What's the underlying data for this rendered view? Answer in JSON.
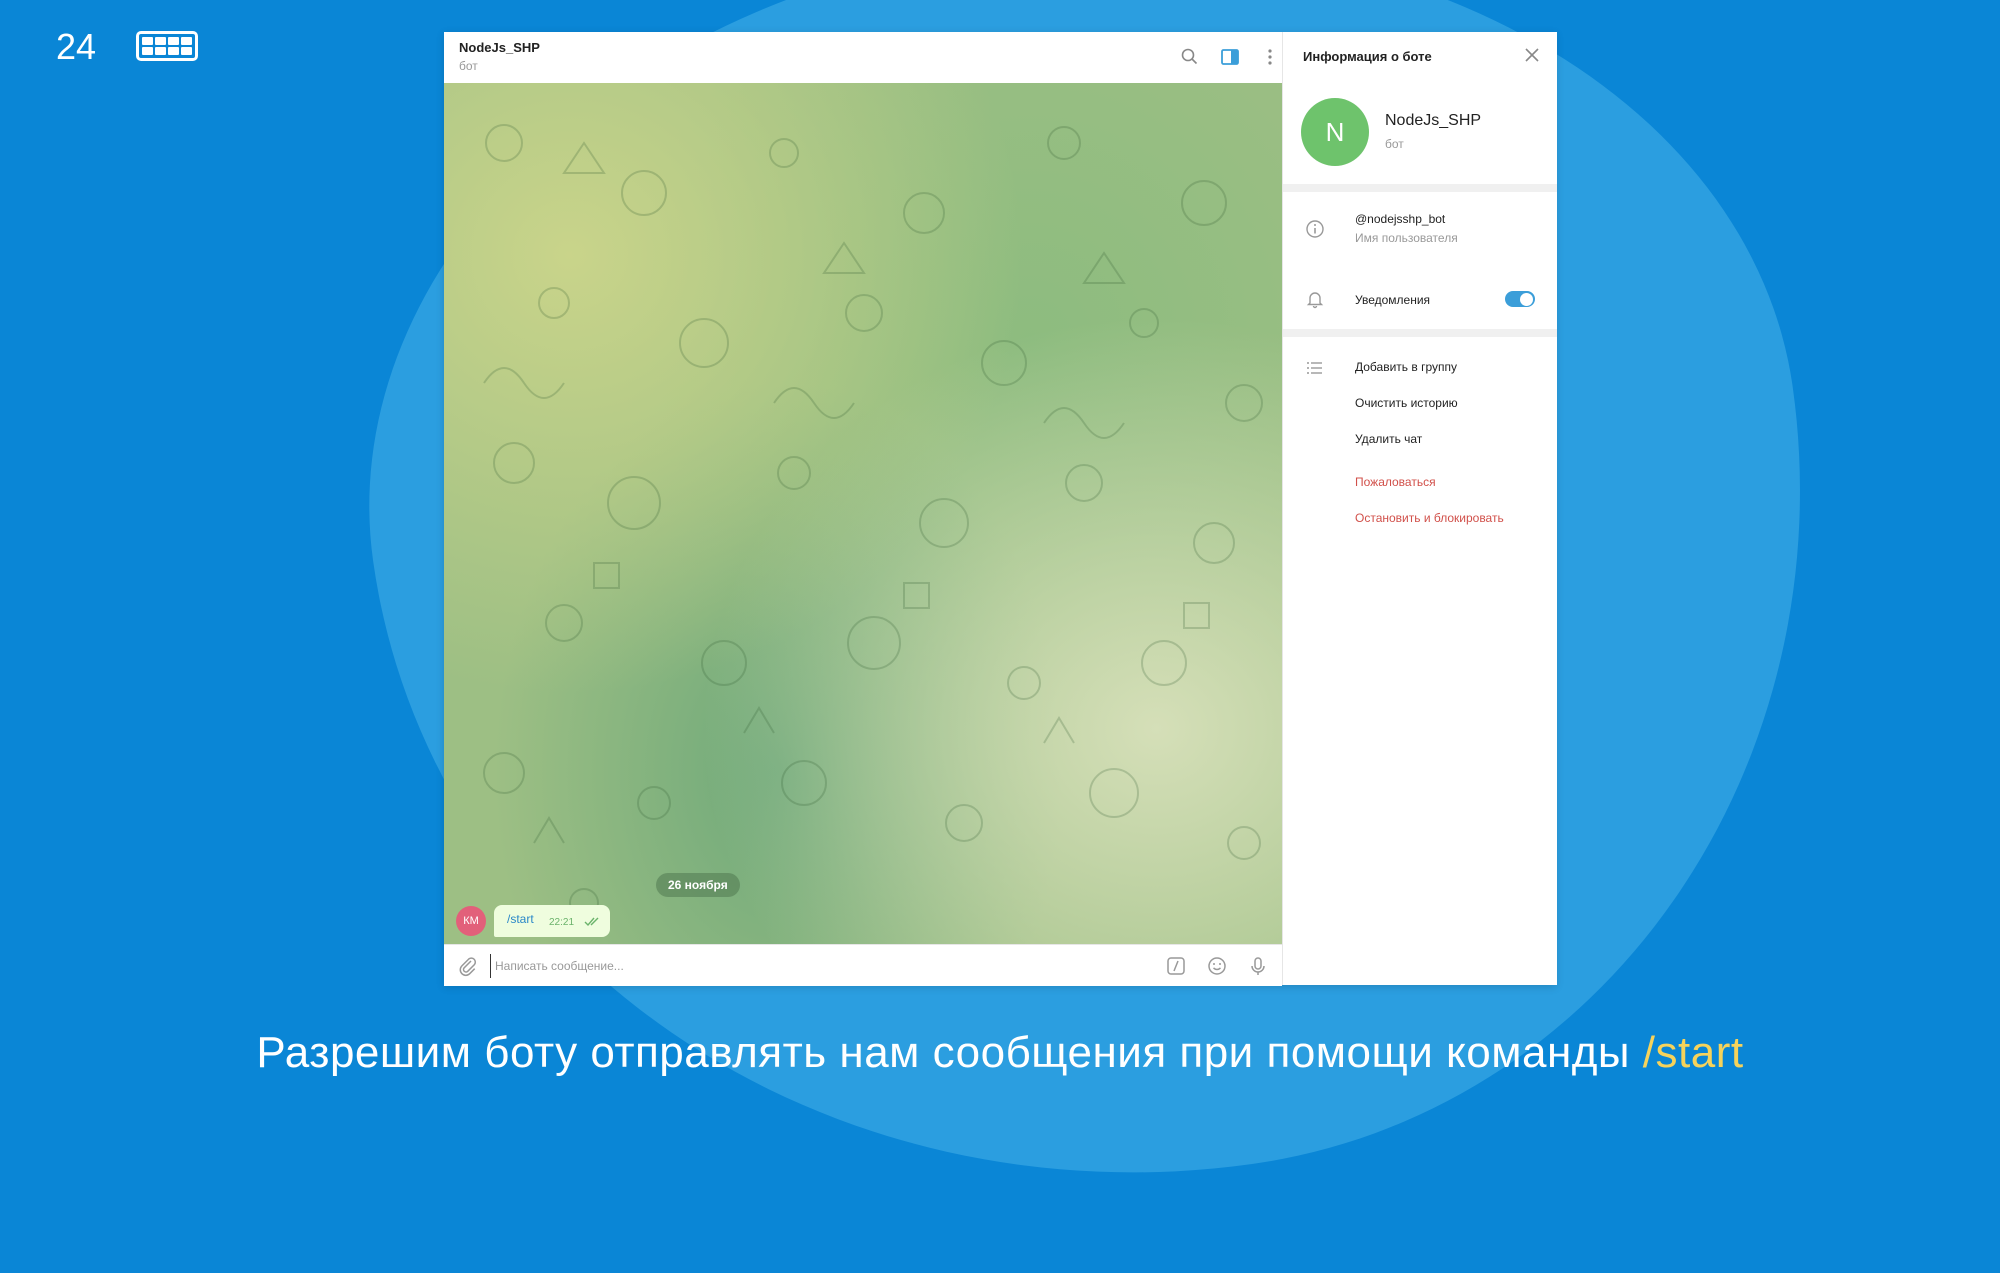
{
  "slide": {
    "number": "24"
  },
  "chat": {
    "title": "NodeJs_SHP",
    "subtitle": "бот",
    "date_label": "26 ноября",
    "message": {
      "avatar_initials": "КМ",
      "text": "/start",
      "time": "22:21"
    },
    "composer_placeholder": "Написать сообщение..."
  },
  "panel": {
    "title": "Информация о боте",
    "bot_avatar_letter": "N",
    "bot_name": "NodeJs_SHP",
    "bot_subtitle": "бот",
    "username": "@nodejsshp_bot",
    "username_label": "Имя пользователя",
    "notifications_label": "Уведомления",
    "notifications_enabled": true,
    "actions": [
      "Добавить в группу",
      "Очистить историю",
      "Удалить чат",
      "Пожаловаться",
      "Остановить и блокировать"
    ]
  },
  "caption": {
    "text": "Разрешим боту отправлять нам сообщения при помощи команды ",
    "accent": "/start"
  },
  "colors": {
    "background": "#0a86d6",
    "accent_yellow": "#f6d35b",
    "danger": "#d1504a",
    "toggle": "#3b9ed9",
    "bot_avatar": "#6ec36c",
    "user_avatar": "#e2607a"
  }
}
